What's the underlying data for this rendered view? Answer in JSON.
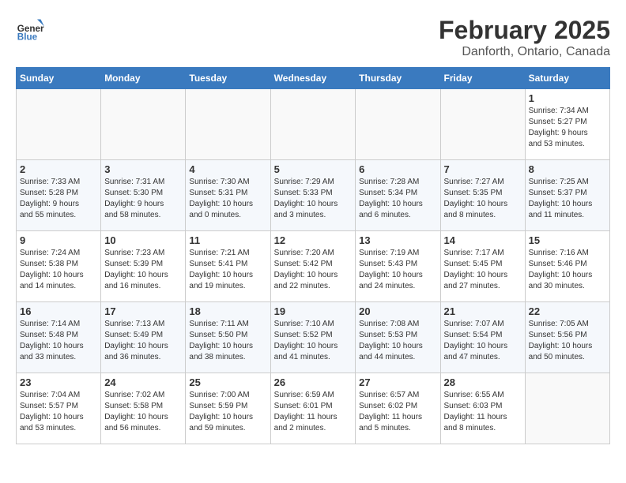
{
  "header": {
    "logo": {
      "line1": "General",
      "line2": "Blue"
    },
    "title": "February 2025",
    "location": "Danforth, Ontario, Canada"
  },
  "weekdays": [
    "Sunday",
    "Monday",
    "Tuesday",
    "Wednesday",
    "Thursday",
    "Friday",
    "Saturday"
  ],
  "weeks": [
    [
      {
        "day": "",
        "info": ""
      },
      {
        "day": "",
        "info": ""
      },
      {
        "day": "",
        "info": ""
      },
      {
        "day": "",
        "info": ""
      },
      {
        "day": "",
        "info": ""
      },
      {
        "day": "",
        "info": ""
      },
      {
        "day": "1",
        "info": "Sunrise: 7:34 AM\nSunset: 5:27 PM\nDaylight: 9 hours\nand 53 minutes."
      }
    ],
    [
      {
        "day": "2",
        "info": "Sunrise: 7:33 AM\nSunset: 5:28 PM\nDaylight: 9 hours\nand 55 minutes."
      },
      {
        "day": "3",
        "info": "Sunrise: 7:31 AM\nSunset: 5:30 PM\nDaylight: 9 hours\nand 58 minutes."
      },
      {
        "day": "4",
        "info": "Sunrise: 7:30 AM\nSunset: 5:31 PM\nDaylight: 10 hours\nand 0 minutes."
      },
      {
        "day": "5",
        "info": "Sunrise: 7:29 AM\nSunset: 5:33 PM\nDaylight: 10 hours\nand 3 minutes."
      },
      {
        "day": "6",
        "info": "Sunrise: 7:28 AM\nSunset: 5:34 PM\nDaylight: 10 hours\nand 6 minutes."
      },
      {
        "day": "7",
        "info": "Sunrise: 7:27 AM\nSunset: 5:35 PM\nDaylight: 10 hours\nand 8 minutes."
      },
      {
        "day": "8",
        "info": "Sunrise: 7:25 AM\nSunset: 5:37 PM\nDaylight: 10 hours\nand 11 minutes."
      }
    ],
    [
      {
        "day": "9",
        "info": "Sunrise: 7:24 AM\nSunset: 5:38 PM\nDaylight: 10 hours\nand 14 minutes."
      },
      {
        "day": "10",
        "info": "Sunrise: 7:23 AM\nSunset: 5:39 PM\nDaylight: 10 hours\nand 16 minutes."
      },
      {
        "day": "11",
        "info": "Sunrise: 7:21 AM\nSunset: 5:41 PM\nDaylight: 10 hours\nand 19 minutes."
      },
      {
        "day": "12",
        "info": "Sunrise: 7:20 AM\nSunset: 5:42 PM\nDaylight: 10 hours\nand 22 minutes."
      },
      {
        "day": "13",
        "info": "Sunrise: 7:19 AM\nSunset: 5:43 PM\nDaylight: 10 hours\nand 24 minutes."
      },
      {
        "day": "14",
        "info": "Sunrise: 7:17 AM\nSunset: 5:45 PM\nDaylight: 10 hours\nand 27 minutes."
      },
      {
        "day": "15",
        "info": "Sunrise: 7:16 AM\nSunset: 5:46 PM\nDaylight: 10 hours\nand 30 minutes."
      }
    ],
    [
      {
        "day": "16",
        "info": "Sunrise: 7:14 AM\nSunset: 5:48 PM\nDaylight: 10 hours\nand 33 minutes."
      },
      {
        "day": "17",
        "info": "Sunrise: 7:13 AM\nSunset: 5:49 PM\nDaylight: 10 hours\nand 36 minutes."
      },
      {
        "day": "18",
        "info": "Sunrise: 7:11 AM\nSunset: 5:50 PM\nDaylight: 10 hours\nand 38 minutes."
      },
      {
        "day": "19",
        "info": "Sunrise: 7:10 AM\nSunset: 5:52 PM\nDaylight: 10 hours\nand 41 minutes."
      },
      {
        "day": "20",
        "info": "Sunrise: 7:08 AM\nSunset: 5:53 PM\nDaylight: 10 hours\nand 44 minutes."
      },
      {
        "day": "21",
        "info": "Sunrise: 7:07 AM\nSunset: 5:54 PM\nDaylight: 10 hours\nand 47 minutes."
      },
      {
        "day": "22",
        "info": "Sunrise: 7:05 AM\nSunset: 5:56 PM\nDaylight: 10 hours\nand 50 minutes."
      }
    ],
    [
      {
        "day": "23",
        "info": "Sunrise: 7:04 AM\nSunset: 5:57 PM\nDaylight: 10 hours\nand 53 minutes."
      },
      {
        "day": "24",
        "info": "Sunrise: 7:02 AM\nSunset: 5:58 PM\nDaylight: 10 hours\nand 56 minutes."
      },
      {
        "day": "25",
        "info": "Sunrise: 7:00 AM\nSunset: 5:59 PM\nDaylight: 10 hours\nand 59 minutes."
      },
      {
        "day": "26",
        "info": "Sunrise: 6:59 AM\nSunset: 6:01 PM\nDaylight: 11 hours\nand 2 minutes."
      },
      {
        "day": "27",
        "info": "Sunrise: 6:57 AM\nSunset: 6:02 PM\nDaylight: 11 hours\nand 5 minutes."
      },
      {
        "day": "28",
        "info": "Sunrise: 6:55 AM\nSunset: 6:03 PM\nDaylight: 11 hours\nand 8 minutes."
      },
      {
        "day": "",
        "info": ""
      }
    ]
  ]
}
